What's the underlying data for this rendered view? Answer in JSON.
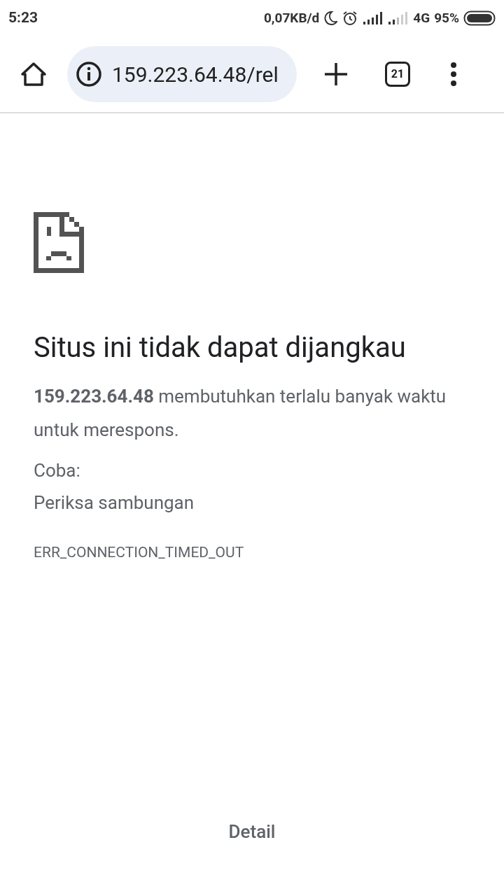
{
  "status_bar": {
    "time": "5:23",
    "data_rate": "0,07KB/d",
    "network": "4G",
    "battery_percent": "95%"
  },
  "toolbar": {
    "url": "159.223.64.48/rel",
    "tab_count": "21"
  },
  "error": {
    "title": "Situs ini tidak dapat dijangkau",
    "message": "**159.223.64.48** membutuhkan terlalu banyak waktu untuk merespons.",
    "try_label": "Coba:",
    "suggestions": [
      "Periksa sambungan"
    ],
    "code": "ERR_CONNECTION_TIMED_OUT"
  },
  "details_button": "Detail"
}
